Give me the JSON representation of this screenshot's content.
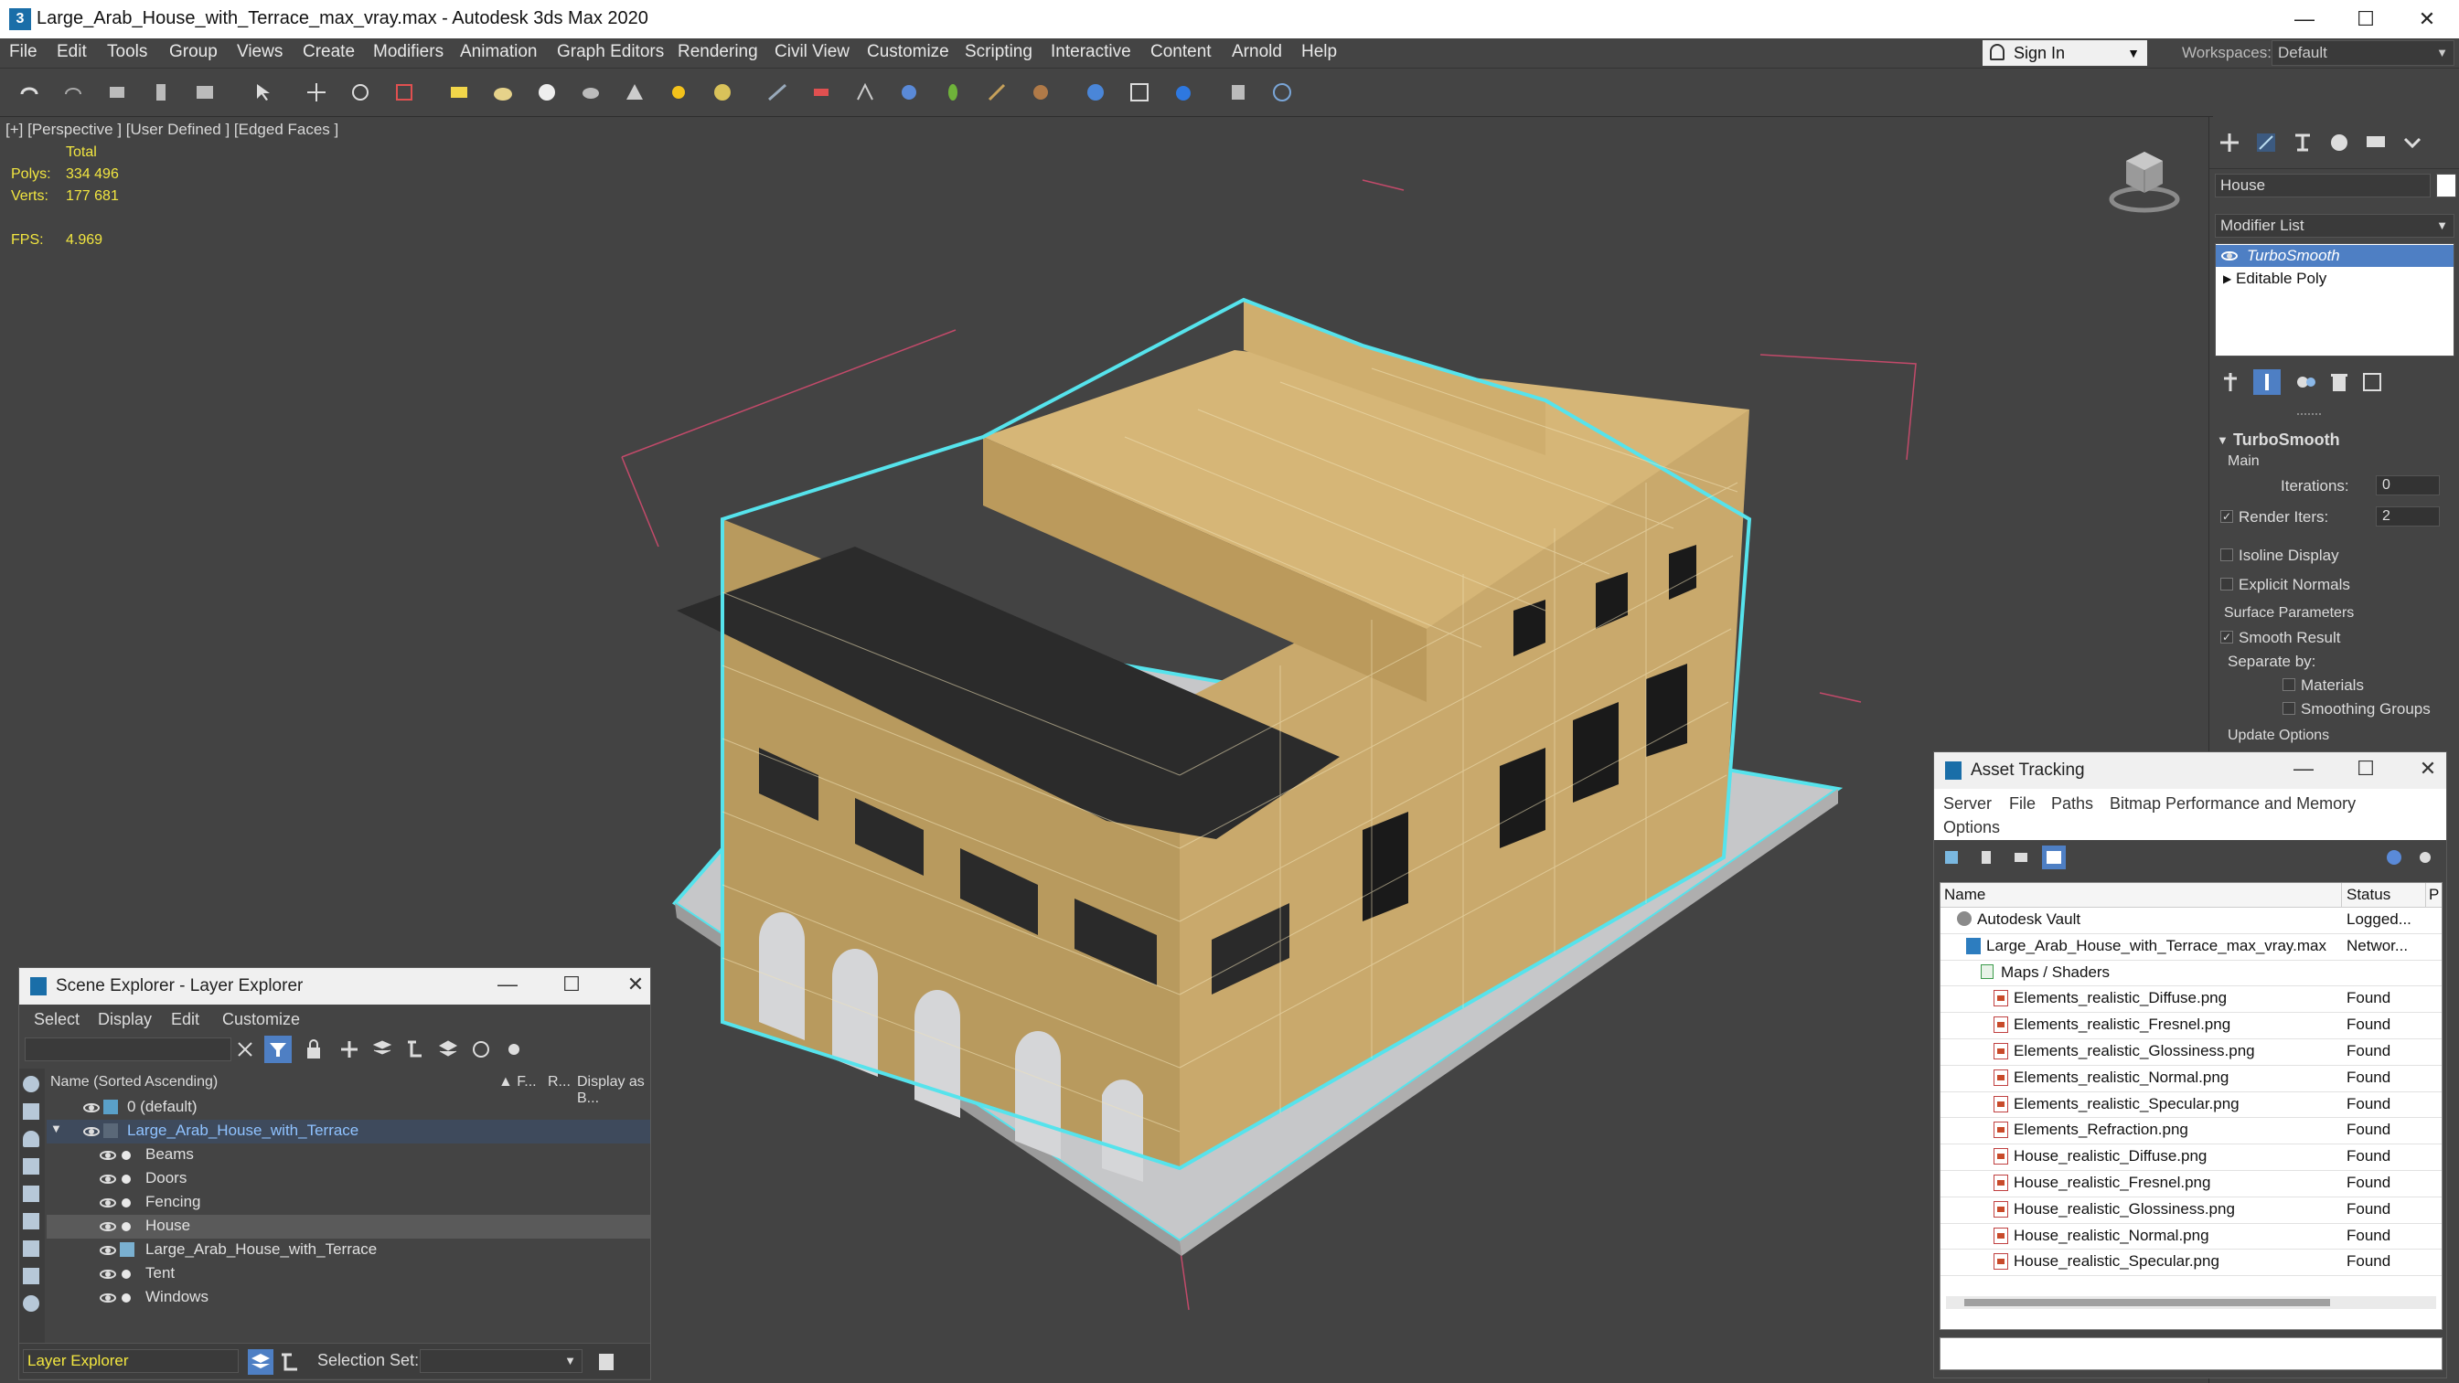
{
  "window": {
    "title": "Large_Arab_House_with_Terrace_max_vray.max - Autodesk 3ds Max 2020",
    "minimize": "—",
    "maximize": "☐",
    "close": "✕"
  },
  "menu": {
    "items": [
      "File",
      "Edit",
      "Tools",
      "Group",
      "Views",
      "Create",
      "Modifiers",
      "Animation",
      "Graph Editors",
      "Rendering",
      "Civil View",
      "Customize",
      "Scripting",
      "Interactive",
      "Content",
      "Arnold",
      "Help"
    ],
    "signin": "Sign In",
    "workspaces_label": "Workspaces:",
    "workspace_value": "Default"
  },
  "viewport": {
    "label": "[+] [Perspective ] [User Defined ] [Edged Faces ]",
    "stats": {
      "total_label": "Total",
      "polys_label": "Polys:",
      "polys_value": "334 496",
      "verts_label": "Verts:",
      "verts_value": "177 681",
      "fps_label": "FPS:",
      "fps_value": "4.969"
    }
  },
  "command_panel": {
    "object_name": "House",
    "modifier_list_label": "Modifier List",
    "stack": [
      "TurboSmooth",
      "Editable Poly"
    ],
    "rollout_title": "TurboSmooth",
    "main_label": "Main",
    "iterations_label": "Iterations:",
    "iterations_value": "0",
    "render_iters_label": "Render Iters:",
    "render_iters_value": "2",
    "isoline_label": "Isoline Display",
    "explicit_normals_label": "Explicit Normals",
    "surface_params_label": "Surface Parameters",
    "smooth_result_label": "Smooth Result",
    "separate_by_label": "Separate by:",
    "materials_label": "Materials",
    "smoothing_groups_label": "Smoothing Groups",
    "update_options_label": "Update Options"
  },
  "scene_explorer": {
    "title": "Scene Explorer - Layer Explorer",
    "menu": [
      "Select",
      "Display",
      "Edit",
      "Customize"
    ],
    "columns": {
      "name": "Name (Sorted Ascending)",
      "f": "▲ F...",
      "r": "R...",
      "display": "Display as B..."
    },
    "rows": [
      {
        "name": "0 (default)",
        "indent": 0,
        "type": "layer"
      },
      {
        "name": "Large_Arab_House_with_Terrace",
        "indent": 0,
        "type": "layer-open"
      },
      {
        "name": "Beams",
        "indent": 1,
        "type": "object"
      },
      {
        "name": "Doors",
        "indent": 1,
        "type": "object"
      },
      {
        "name": "Fencing",
        "indent": 1,
        "type": "object"
      },
      {
        "name": "House",
        "indent": 1,
        "type": "object-selected"
      },
      {
        "name": "Large_Arab_House_with_Terrace",
        "indent": 1,
        "type": "group"
      },
      {
        "name": "Tent",
        "indent": 1,
        "type": "object"
      },
      {
        "name": "Windows",
        "indent": 1,
        "type": "object"
      }
    ],
    "footer_layer": "Layer Explorer",
    "selection_set_label": "Selection Set:"
  },
  "asset_tracking": {
    "title": "Asset Tracking",
    "menu": [
      "Server",
      "File",
      "Paths",
      "Bitmap Performance and Memory",
      "Options"
    ],
    "columns": {
      "name": "Name",
      "status": "Status",
      "p": "P"
    },
    "rows": [
      {
        "name": "Autodesk Vault",
        "status": "Logged...",
        "indent": 0
      },
      {
        "name": "Large_Arab_House_with_Terrace_max_vray.max",
        "status": "Networ...",
        "indent": 1
      },
      {
        "name": "Maps / Shaders",
        "status": "",
        "indent": 2
      },
      {
        "name": "Elements_realistic_Diffuse.png",
        "status": "Found",
        "indent": 3
      },
      {
        "name": "Elements_realistic_Fresnel.png",
        "status": "Found",
        "indent": 3
      },
      {
        "name": "Elements_realistic_Glossiness.png",
        "status": "Found",
        "indent": 3
      },
      {
        "name": "Elements_realistic_Normal.png",
        "status": "Found",
        "indent": 3
      },
      {
        "name": "Elements_realistic_Specular.png",
        "status": "Found",
        "indent": 3
      },
      {
        "name": "Elements_Refraction.png",
        "status": "Found",
        "indent": 3
      },
      {
        "name": "House_realistic_Diffuse.png",
        "status": "Found",
        "indent": 3
      },
      {
        "name": "House_realistic_Fresnel.png",
        "status": "Found",
        "indent": 3
      },
      {
        "name": "House_realistic_Glossiness.png",
        "status": "Found",
        "indent": 3
      },
      {
        "name": "House_realistic_Normal.png",
        "status": "Found",
        "indent": 3
      },
      {
        "name": "House_realistic_Specular.png",
        "status": "Found",
        "indent": 3
      }
    ]
  }
}
